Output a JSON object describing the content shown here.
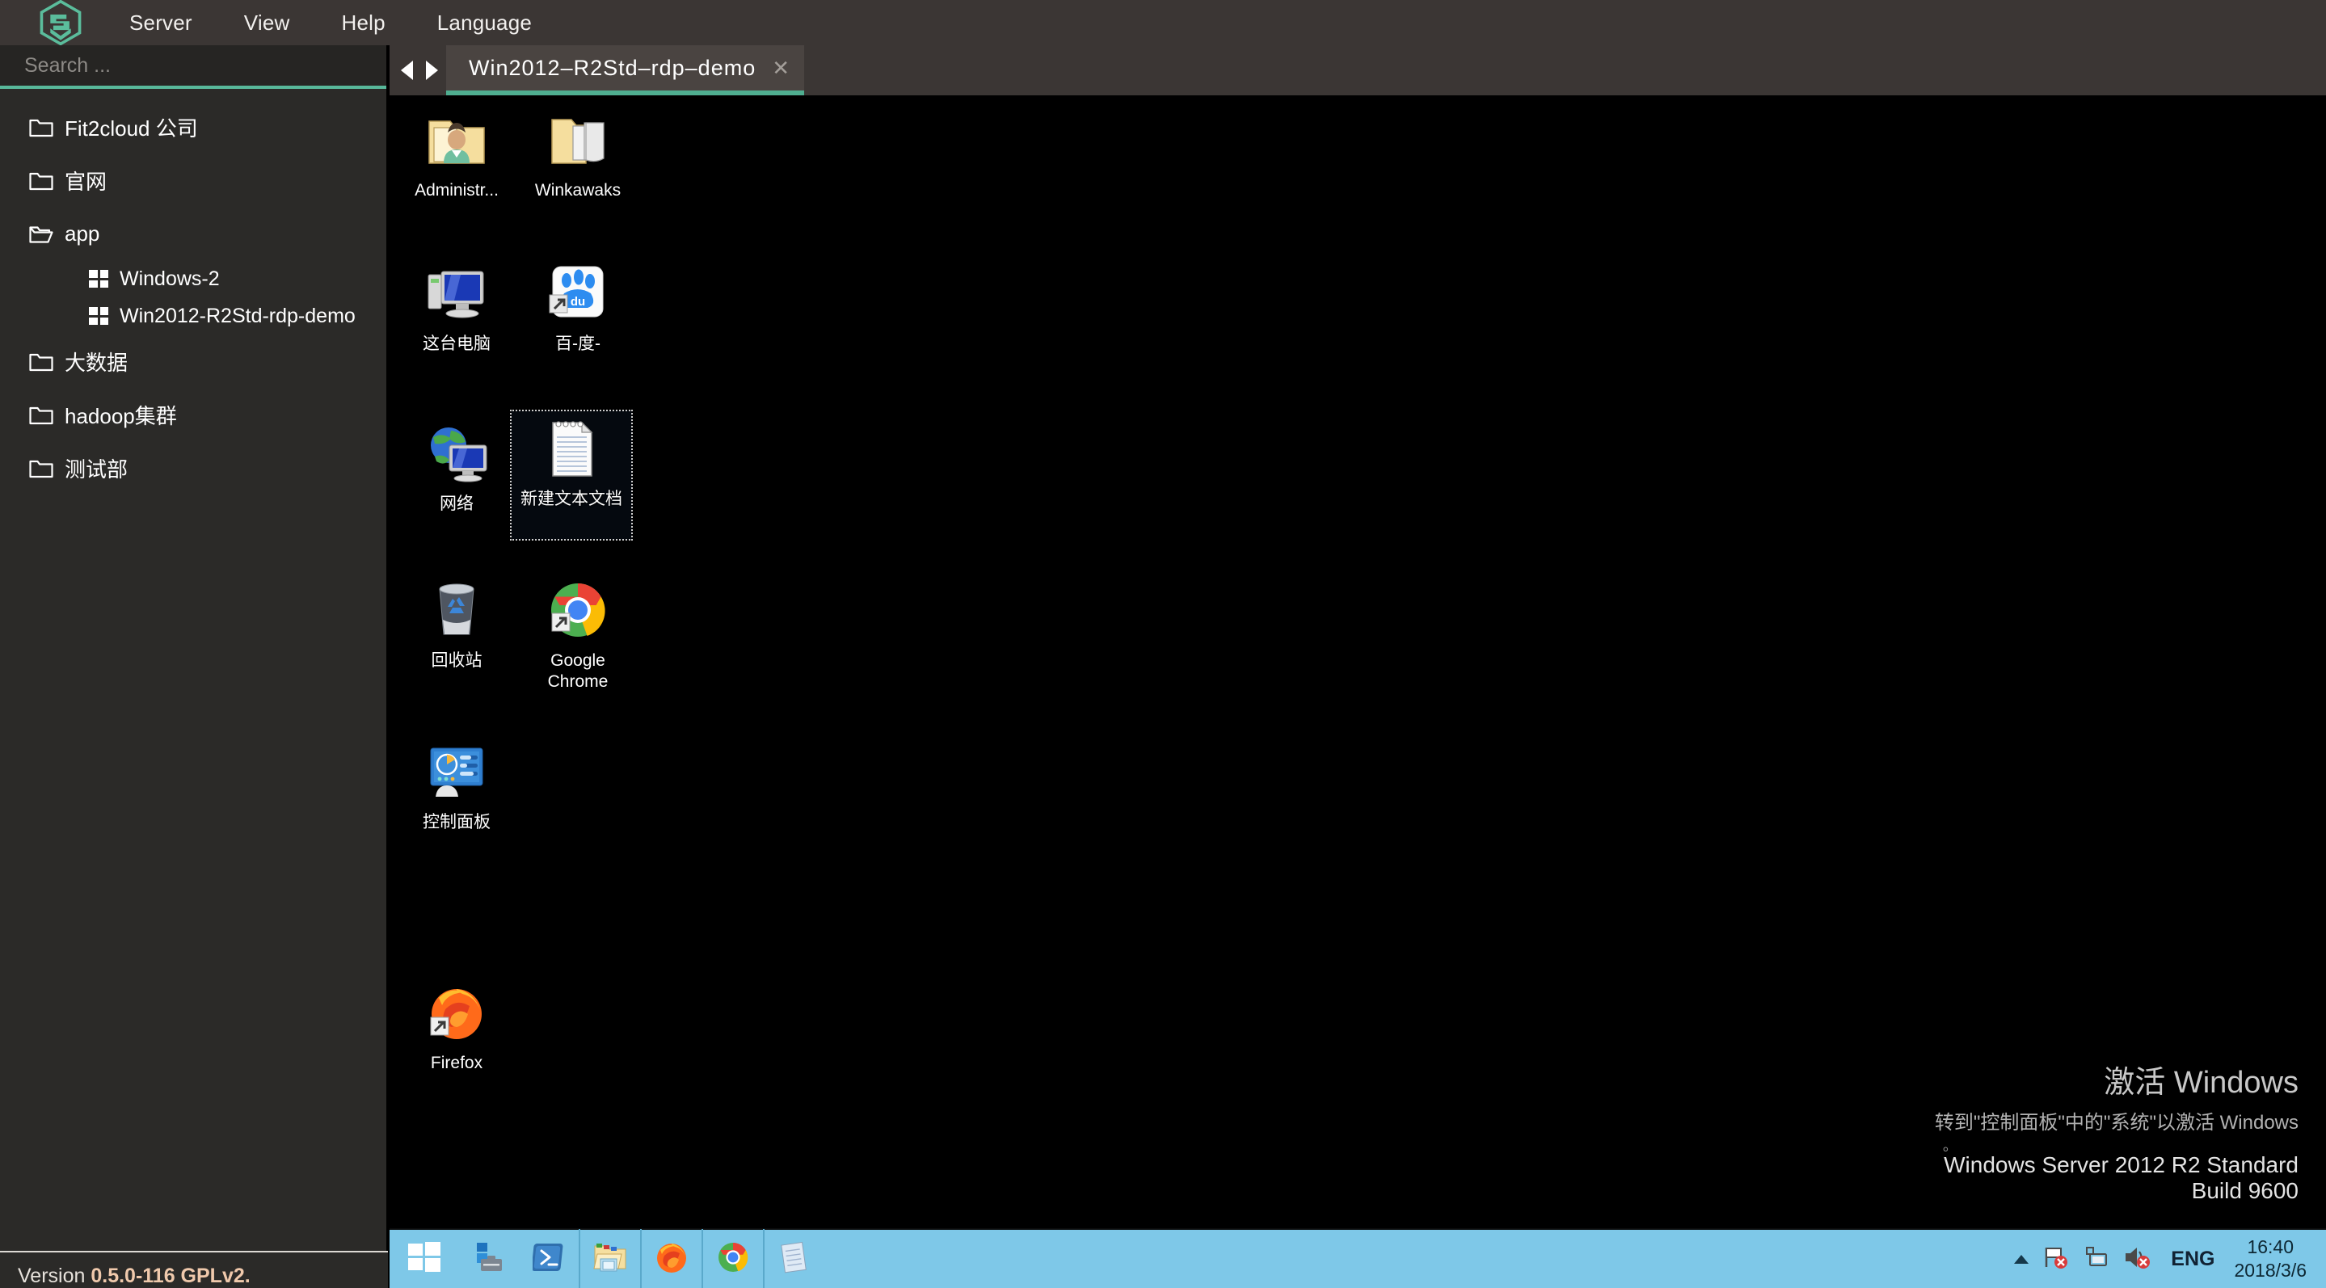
{
  "app": {
    "logo_name": "guacamole-hex-logo",
    "accent": "#58b89a",
    "menu": [
      {
        "label": "Server"
      },
      {
        "label": "View"
      },
      {
        "label": "Help"
      },
      {
        "label": "Language"
      }
    ]
  },
  "sidebar": {
    "search": {
      "placeholder": "Search ...",
      "value": ""
    },
    "tree": [
      {
        "label": "Fit2cloud 公司",
        "icon": "folder-icon",
        "type": "folder",
        "expanded": false,
        "children": []
      },
      {
        "label": "官网",
        "icon": "folder-icon",
        "type": "folder",
        "expanded": false,
        "children": []
      },
      {
        "label": "app",
        "icon": "folder-open-icon",
        "type": "folder",
        "expanded": true,
        "children": [
          {
            "label": "Windows-2",
            "icon": "windows-icon",
            "type": "connection"
          },
          {
            "label": "Win2012-R2Std-rdp-demo",
            "icon": "windows-icon",
            "type": "connection"
          }
        ]
      },
      {
        "label": "大数据",
        "icon": "folder-icon",
        "type": "folder",
        "expanded": false,
        "children": []
      },
      {
        "label": "hadoop集群",
        "icon": "folder-icon",
        "type": "folder",
        "expanded": false,
        "children": []
      },
      {
        "label": "测试部",
        "icon": "folder-icon",
        "type": "folder",
        "expanded": false,
        "children": []
      }
    ],
    "version_prefix": "Version ",
    "version_value": "0.5.0-116 GPLv2."
  },
  "tabstrip": {
    "prev_icon": "arrow-left-icon",
    "next_icon": "arrow-right-icon",
    "tabs": [
      {
        "title": "Win2012–R2Std–rdp–demo",
        "active": true,
        "close_label": "✕"
      }
    ]
  },
  "desktop": {
    "icons": [
      {
        "name": "Administr...",
        "icon": "folder-user-icon",
        "selected": false,
        "col": 0,
        "row": 0
      },
      {
        "name": "Winkawaks",
        "icon": "folder-files-icon",
        "selected": false,
        "col": 1,
        "row": 0
      },
      {
        "name": "这台电脑",
        "icon": "this-pc-icon",
        "selected": false,
        "col": 0,
        "row": 1
      },
      {
        "name": "百-度-",
        "icon": "baidu-icon",
        "selected": false,
        "col": 1,
        "row": 1
      },
      {
        "name": "网络",
        "icon": "network-icon",
        "selected": false,
        "col": 0,
        "row": 2
      },
      {
        "name": "新建文本文档",
        "icon": "text-document-icon",
        "selected": true,
        "col": 1,
        "row": 2
      },
      {
        "name": "回收站",
        "icon": "recycle-bin-icon",
        "selected": false,
        "col": 0,
        "row": 3
      },
      {
        "name": "Google Chrome",
        "icon": "chrome-icon",
        "selected": false,
        "col": 1,
        "row": 3
      },
      {
        "name": "控制面板",
        "icon": "control-panel-icon",
        "selected": false,
        "col": 0,
        "row": 4
      },
      {
        "name": "Firefox",
        "icon": "firefox-icon",
        "selected": false,
        "col": 0,
        "row": 6
      }
    ],
    "watermark": {
      "title": "激活 Windows",
      "subtitle": "转到\"控制面板\"中的\"系统\"以激活 Windows",
      "edition": "Windows Server 2012 R2 Standard",
      "build": "Build 9600",
      "degree_mark": "。"
    }
  },
  "taskbar": {
    "buttons": [
      {
        "icon": "start-icon",
        "label": "Start"
      },
      {
        "icon": "server-manager-icon",
        "label": "Server Manager"
      },
      {
        "icon": "powershell-icon",
        "label": "Windows PowerShell"
      },
      {
        "icon": "file-explorer-icon",
        "label": "File Explorer"
      },
      {
        "icon": "firefox-taskbar-icon",
        "label": "Firefox"
      },
      {
        "icon": "chrome-taskbar-icon",
        "label": "Google Chrome"
      },
      {
        "icon": "notepad-taskbar-icon",
        "label": "Notepad"
      }
    ],
    "tray": {
      "expand_icon": "caret-up-icon",
      "items": [
        {
          "icon": "network-flag-error-icon"
        },
        {
          "icon": "network-monitor-icon"
        },
        {
          "icon": "volume-muted-icon"
        }
      ],
      "language": "ENG",
      "time": "16:40",
      "date": "2018/3/6"
    }
  }
}
